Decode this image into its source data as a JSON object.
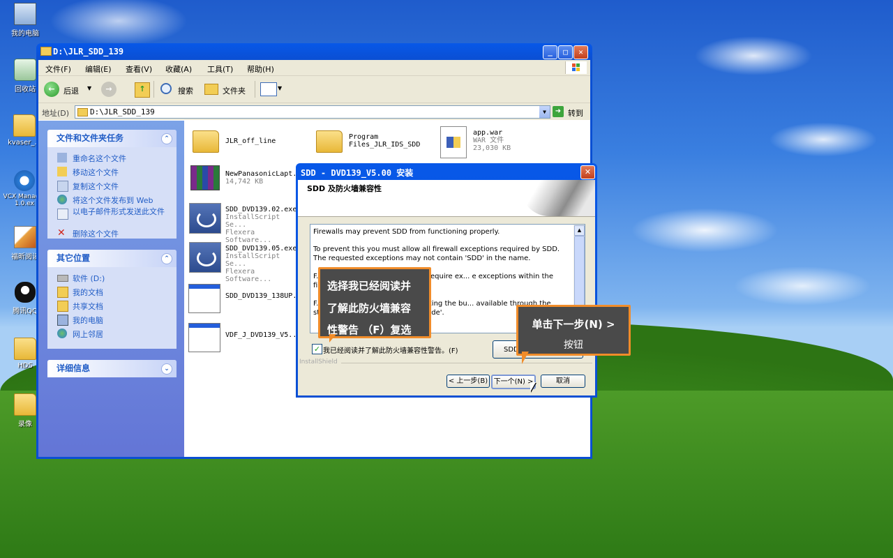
{
  "desktop": {
    "icons": [
      "我的电脑",
      "回收站",
      "kvaser_...",
      "VCX Manager 1.0.ex",
      "福昕阅读",
      "腾讯QQ",
      "HDS",
      "录像"
    ]
  },
  "explorer": {
    "title": "D:\\JLR_SDD_139",
    "menu": [
      "文件(F)",
      "编辑(E)",
      "查看(V)",
      "收藏(A)",
      "工具(T)",
      "帮助(H)"
    ],
    "toolbar": {
      "back": "后退",
      "search": "搜索",
      "folders": "文件夹"
    },
    "address": {
      "label": "地址(D)",
      "value": "D:\\JLR_SDD_139",
      "go": "转到"
    },
    "tasks": {
      "title": "文件和文件夹任务",
      "items": [
        "重命名这个文件",
        "移动这个文件",
        "复制这个文件",
        "将这个文件发布到 Web",
        "以电子邮件形式发送此文件",
        "删除这个文件"
      ]
    },
    "places": {
      "title": "其它位置",
      "items": [
        "软件 (D:)",
        "我的文档",
        "共享文档",
        "我的电脑",
        "网上邻居"
      ]
    },
    "details": {
      "title": "详细信息"
    },
    "files": [
      {
        "name": "JLR_off_line"
      },
      {
        "name": "Program Files_JLR_IDS_SDD"
      },
      {
        "name": "app.war",
        "type": "WAR 文件",
        "size": "23,030 KB"
      },
      {
        "name": "NewPanasonicLapt...",
        "size": "14,742 KB"
      },
      {
        "name": "SDD_DVD139.02.exe",
        "type": "InstallScript Se...",
        "vendor": "Flexera Software..."
      },
      {
        "name": "SDD_DVD139.05.exe",
        "type": "InstallScript Se...",
        "vendor": "Flexera Software..."
      },
      {
        "name": "SDD_DVD139_138UP..."
      },
      {
        "name": "VDF_J_DVD139_V5..."
      }
    ]
  },
  "dialog": {
    "title": "SDD - DVD139_V5.00 安装",
    "header": "SDD 及防火墙兼容性",
    "text": [
      "Firewalls may prevent SDD from functioning properly.",
      "To prevent this you must allow all firewall exceptions required by SDD. The requested exceptions may not contain 'SDD' in the name.",
      "F... ompted by your firewall may require ex... e exceptions within the firewall package.",
      "F... Troubleshooting Guide by clicking the bu... available through the start ->... DD Troubleshooting Guide'."
    ],
    "checkbox": "我已经阅读并了解此防火墙兼容性警告。(F)",
    "sdd_btn": "SDD",
    "brand": "InstallShield",
    "back": "< 上一步(B)",
    "next": "下一个(N) >",
    "cancel": "取消"
  },
  "callouts": {
    "left": "选择我已经阅读并了解此防火墙兼容性警告（F）复选",
    "left_l1": "选择我已经阅读并",
    "left_l2": "了解此防火墙兼容",
    "left_l3": "性警告 （F）复选",
    "right_l1": "单击下一步(N) >",
    "right_l2": "按钮"
  },
  "colors": {
    "accent": "#f08c2a",
    "titlebar": "#0a4fd3",
    "link": "#215dc6"
  }
}
